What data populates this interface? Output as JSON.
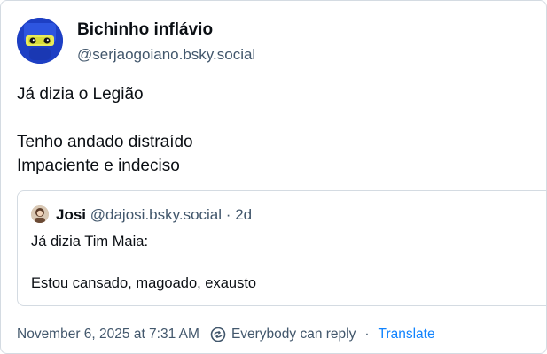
{
  "author": {
    "display_name": "Bichinho inflávio",
    "handle": "@serjaogoiano.bsky.social"
  },
  "post": {
    "lines": [
      "Já dizia o Legião",
      "",
      "Tenho andado distraído",
      "Impaciente e indeciso"
    ]
  },
  "quote": {
    "name": "Josi",
    "handle": "@dajosi.bsky.social",
    "separator": "·",
    "time": "2d",
    "lines": [
      "Já dizia Tim Maia:",
      "",
      "Estou cansado, magoado, exausto"
    ]
  },
  "footer": {
    "timestamp": "November 6, 2025 at 7:31 AM",
    "reply_setting": "Everybody can reply",
    "separator": "·",
    "translate_label": "Translate"
  },
  "icons": {
    "reply_setting": "globe-reply-icon"
  },
  "colors": {
    "text_primary": "#0b0f14",
    "text_secondary": "#42576c",
    "link": "#1083fe",
    "border": "#d4dbe2"
  }
}
